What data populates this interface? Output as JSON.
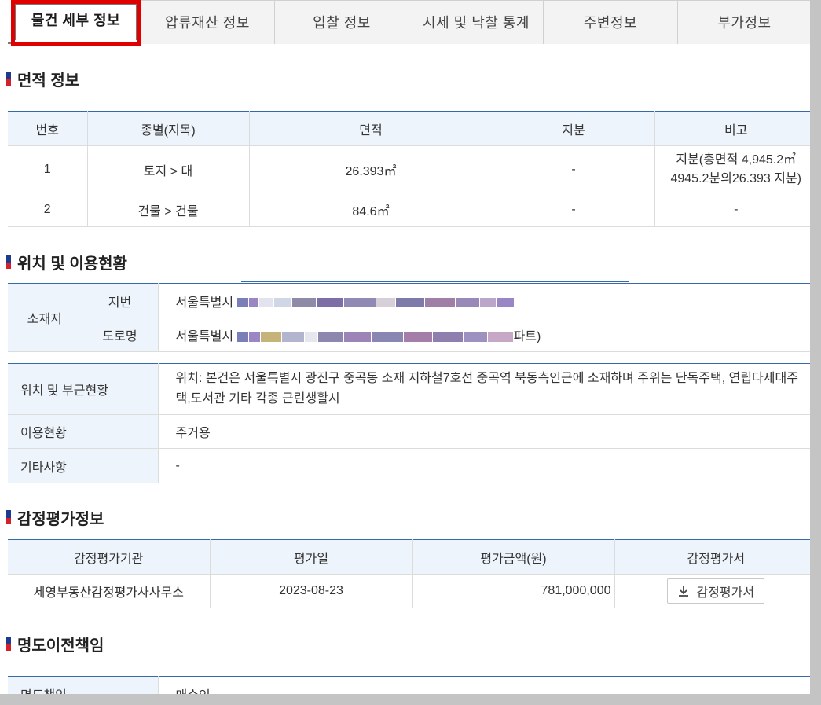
{
  "tabs": [
    "물건 세부 정보",
    "압류재산 정보",
    "입찰 정보",
    "시세 및 낙찰 통계",
    "주변정보",
    "부가정보"
  ],
  "area": {
    "title": "면적 정보",
    "headers": [
      "번호",
      "종별(지목)",
      "면적",
      "지분",
      "비고"
    ],
    "rows": [
      {
        "no": "1",
        "type": "토지 > 대",
        "area": "26.393㎡",
        "share": "-",
        "note": "지분(총면적 4,945.2㎡ 4945.2분의26.393 지분)"
      },
      {
        "no": "2",
        "type": "건물 > 건물",
        "area": "84.6㎡",
        "share": "-",
        "note": "-"
      }
    ]
  },
  "location": {
    "title": "위치 및 이용현황",
    "address_label": "소재지",
    "jibun_label": "지번",
    "road_label": "도로명",
    "jibun_value": "서울특별시",
    "road_value": "서울특별시",
    "road_suffix": "파트)",
    "surroundings_label": "위치 및 부근현황",
    "surroundings_value": "위치: 본건은 서울특별시 광진구 중곡동 소재 지하철7호선 중곡역 북동측인근에 소재하며 주위는 단독주택, 연립다세대주택,도서관 기타 각종 근린생활시",
    "usage_label": "이용현황",
    "usage_value": "주거용",
    "etc_label": "기타사항",
    "etc_value": "-"
  },
  "appraisal": {
    "title": "감정평가정보",
    "headers": [
      "감정평가기관",
      "평가일",
      "평가금액(원)",
      "감정평가서"
    ],
    "row": {
      "org": "세영부동산감정평가사사무소",
      "date": "2023-08-23",
      "amount": "781,000,000",
      "button": "감정평가서"
    }
  },
  "transfer": {
    "title": "명도이전책임",
    "label": "명도책임",
    "value": "매수인"
  },
  "colors": {
    "accent": "#3569a8",
    "highlight": "#e00000",
    "header_bg": "#eef4fb"
  }
}
